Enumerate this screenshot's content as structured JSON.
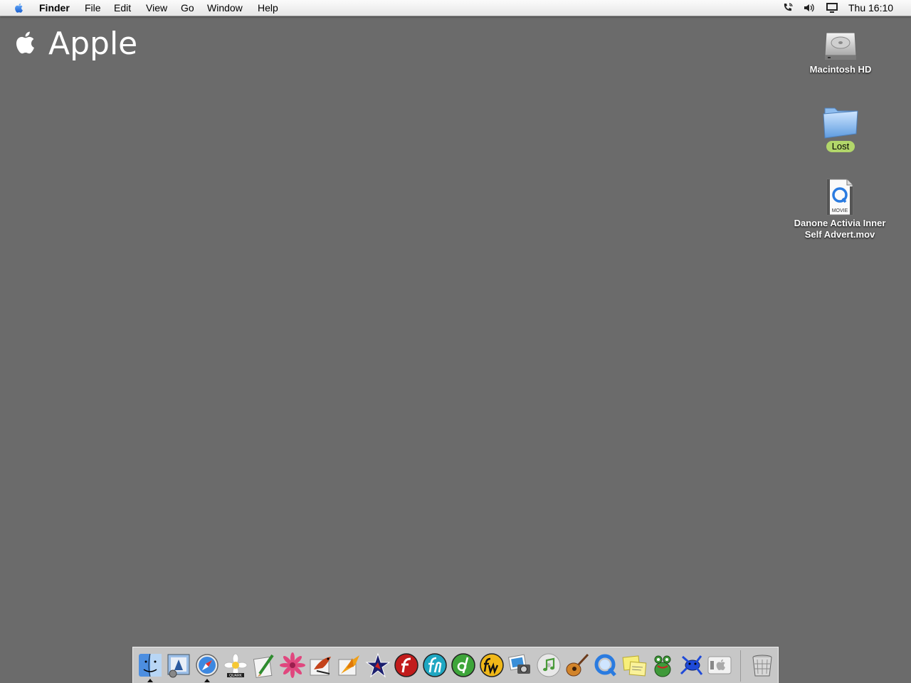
{
  "menubar": {
    "app_name": "Finder",
    "items": [
      "File",
      "Edit",
      "View",
      "Go",
      "Window",
      "Help"
    ],
    "clock": "Thu 16:10"
  },
  "brand": {
    "text": "Apple"
  },
  "desktop": {
    "icons": [
      {
        "label": "Macintosh HD",
        "icon": "hard-drive-icon"
      },
      {
        "label": "Lost",
        "icon": "folder-icon",
        "selected": true
      },
      {
        "label": "Danone Activia Inner Self Advert.mov",
        "icon": "quicktime-movie-icon",
        "badge": "MOVIE"
      }
    ]
  },
  "dock": {
    "apps": [
      {
        "name": "finder-icon",
        "running": true
      },
      {
        "name": "mail-icon"
      },
      {
        "name": "safari-icon",
        "running": true
      },
      {
        "name": "quark-icon",
        "badge": "QUARK"
      },
      {
        "name": "painter-icon"
      },
      {
        "name": "flower-icon"
      },
      {
        "name": "bird-icon"
      },
      {
        "name": "origami-bird-icon"
      },
      {
        "name": "star-icon"
      },
      {
        "name": "flash-icon"
      },
      {
        "name": "freehand-icon"
      },
      {
        "name": "dreamweaver-icon"
      },
      {
        "name": "fireworks-icon"
      },
      {
        "name": "iphoto-icon"
      },
      {
        "name": "itunes-icon"
      },
      {
        "name": "garageband-icon"
      },
      {
        "name": "quicktime-icon"
      },
      {
        "name": "stickies-icon"
      },
      {
        "name": "frog-icon"
      },
      {
        "name": "dart-frog-icon"
      },
      {
        "name": "apple-id-icon"
      }
    ],
    "trash": "trash-icon"
  },
  "colors": {
    "desktop": "#6b6b6b",
    "selection": "#b2d66a"
  }
}
